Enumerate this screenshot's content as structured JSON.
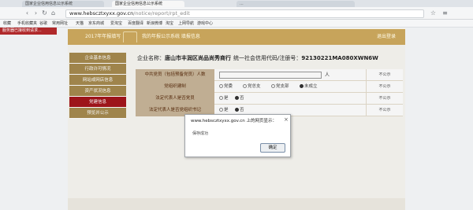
{
  "browser": {
    "tabs": [
      {
        "label": "国家企业信用信息公示系统"
      },
      {
        "label": "国家企业信用信息公示系统"
      },
      {
        "label": "..."
      }
    ],
    "url_domain": "www.hebscztxyxx.gov.cn",
    "url_path": "/notice/report/rpt_edit",
    "bookmarks": [
      "收藏",
      "手机收藏夹",
      "谷歌",
      "常用网址",
      "天猫",
      "京东商城",
      "爱淘宝",
      "百度翻译",
      "新浪微博",
      "淘宝",
      "上网导航",
      "游戏中心"
    ]
  },
  "alert_strip": {
    "label": "服务器已接收到请求..."
  },
  "site": {
    "header": {
      "left_text": "2017年年报填写",
      "mid_text": "我的年报公示系统 填报信息",
      "right_text": "退出登录"
    },
    "sidebar": [
      {
        "label": "企业基本信息",
        "active": false
      },
      {
        "label": "行政许可情况",
        "active": false
      },
      {
        "label": "网站或网店信息",
        "active": false
      },
      {
        "label": "资产状况信息",
        "active": false
      },
      {
        "label": "党建信息",
        "active": true
      },
      {
        "label": "预览并公示",
        "active": false
      }
    ],
    "enterprise_label": "企业名称：",
    "enterprise_name": "唐山市丰润区尚品尚秀商行",
    "code_label": "统一社会信用代码/注册号：",
    "code_value": "92130221MA080XWN6W",
    "form": {
      "rows": [
        {
          "label": "中共党员（包括预备党员）人数",
          "unit": "人",
          "public": "不公示"
        },
        {
          "label": "党组织建制",
          "options": [
            "党委",
            "党总支",
            "党支部",
            "未成立"
          ],
          "selected": 3,
          "public": "不公示"
        },
        {
          "label": "法定代表人是否党员",
          "options": [
            "是",
            "否"
          ],
          "selected": 1,
          "public": "不公示"
        },
        {
          "label": "法定代表人是否党组织书记",
          "options": [
            "是",
            "否"
          ],
          "selected": 1,
          "public": "不公示"
        }
      ]
    }
  },
  "dialog": {
    "title": "www.hebscztxyxx.gov.cn 上的网页显示：",
    "close": "×",
    "message": "保存成功",
    "ok_label": "确定"
  },
  "colors": {
    "gold": "#c7a45b",
    "sidebar": "#a68a4f",
    "active": "#a4151c",
    "label_bg": "#c8b69a"
  }
}
